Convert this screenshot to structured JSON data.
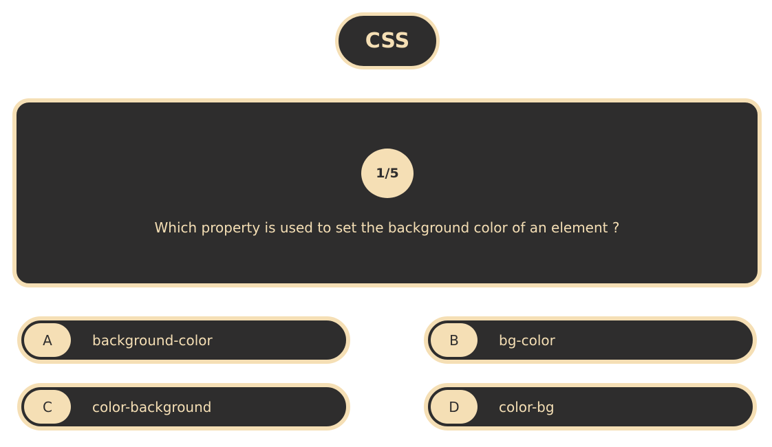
{
  "theme": {
    "dark": "#2e2d2d",
    "accent": "#f5dfb5",
    "background": "#ffffff"
  },
  "quiz": {
    "subject": "CSS",
    "counter": "1/5",
    "question": "Which property is used to set the background color of an element ?",
    "options": [
      {
        "letter": "A",
        "text": "background-color"
      },
      {
        "letter": "B",
        "text": "bg-color"
      },
      {
        "letter": "C",
        "text": "color-background"
      },
      {
        "letter": "D",
        "text": "color-bg"
      }
    ]
  }
}
